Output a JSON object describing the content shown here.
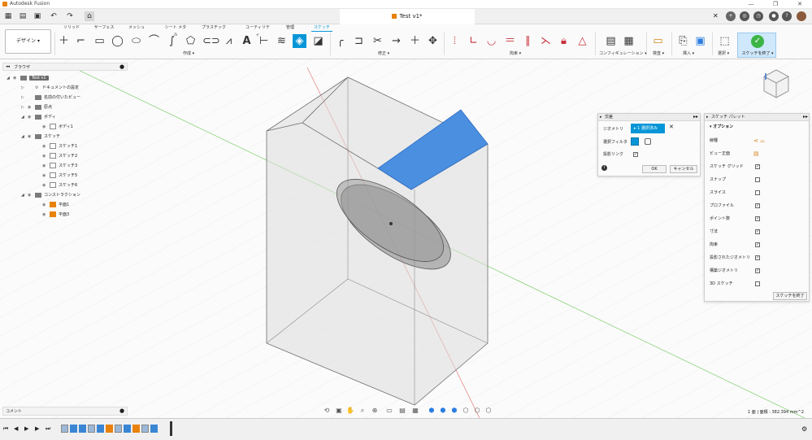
{
  "app_title": "Autodesk Fusion",
  "document_tab": "Test v1*",
  "ribbon_tabs": [
    "ソリッド",
    "サーフェス",
    "メッシュ",
    "シート メタル",
    "プラスチック",
    "ユーティリティ",
    "管理",
    "スケッチ"
  ],
  "active_tab": "スケッチ",
  "workspace_button": "デザイン ▾",
  "groups": {
    "create": "作成 ▾",
    "modify": "修正 ▾",
    "constraints": "拘束 ▾",
    "configure": "コンフィギュレーション ▾",
    "inspect": "検査 ▾",
    "insert": "挿入 ▾",
    "select": "選択 ▾",
    "finish": "スケッチを終了 ▾"
  },
  "browser": {
    "title": "ブラウザ",
    "items": [
      {
        "label": "Test v1",
        "level": 0,
        "kind": "root"
      },
      {
        "label": "ドキュメントの設定",
        "level": 1,
        "kind": "settings"
      },
      {
        "label": "名前の付いたビュー",
        "level": 1,
        "kind": "folder"
      },
      {
        "label": "原点",
        "level": 1,
        "kind": "folder"
      },
      {
        "label": "ボディ",
        "level": 1,
        "kind": "folder"
      },
      {
        "label": "ボディ1",
        "level": 2,
        "kind": "body"
      },
      {
        "label": "スケッチ",
        "level": 1,
        "kind": "folder"
      },
      {
        "label": "スケッチ1",
        "level": 2,
        "kind": "sketch"
      },
      {
        "label": "スケッチ2",
        "level": 2,
        "kind": "sketch"
      },
      {
        "label": "スケッチ3",
        "level": 2,
        "kind": "sketch"
      },
      {
        "label": "スケッチ5",
        "level": 2,
        "kind": "sketch"
      },
      {
        "label": "スケッチ6",
        "level": 2,
        "kind": "sketch"
      },
      {
        "label": "コンストラクション",
        "level": 1,
        "kind": "folder"
      },
      {
        "label": "平面1",
        "level": 2,
        "kind": "plane"
      },
      {
        "label": "平面3",
        "level": 2,
        "kind": "plane"
      }
    ]
  },
  "intersect_dialog": {
    "title": "交差",
    "geometry_label": "ジオメトリ",
    "geometry_value": "1 選択済み",
    "filter_label": "選択フィルタ",
    "link_label": "投影リンク",
    "ok": "OK",
    "cancel": "キャンセル"
  },
  "sketch_palette": {
    "title": "スケッチ パレット",
    "section": "オプション",
    "options": [
      {
        "label": "線種",
        "type": "icons"
      },
      {
        "label": "ビュー正面",
        "type": "icon"
      },
      {
        "label": "スケッチ グリッド",
        "checked": true
      },
      {
        "label": "スナップ",
        "checked": false
      },
      {
        "label": "スライス",
        "checked": false
      },
      {
        "label": "プロファイル",
        "checked": true
      },
      {
        "label": "ポイント数",
        "checked": true
      },
      {
        "label": "寸法",
        "checked": true
      },
      {
        "label": "拘束",
        "checked": true
      },
      {
        "label": "投影されたジオメトリ",
        "checked": true
      },
      {
        "label": "構築ジオメトリ",
        "checked": true
      },
      {
        "label": "3D スケッチ",
        "checked": false
      }
    ],
    "finish_button": "スケッチを終了"
  },
  "comments_label": "コメント",
  "status_text": "1 面 | 面積 : 382.394 mm^2",
  "colors": {
    "accent": "#0696d7",
    "selection": "#4a8fe0",
    "finish": "#3cb546"
  }
}
